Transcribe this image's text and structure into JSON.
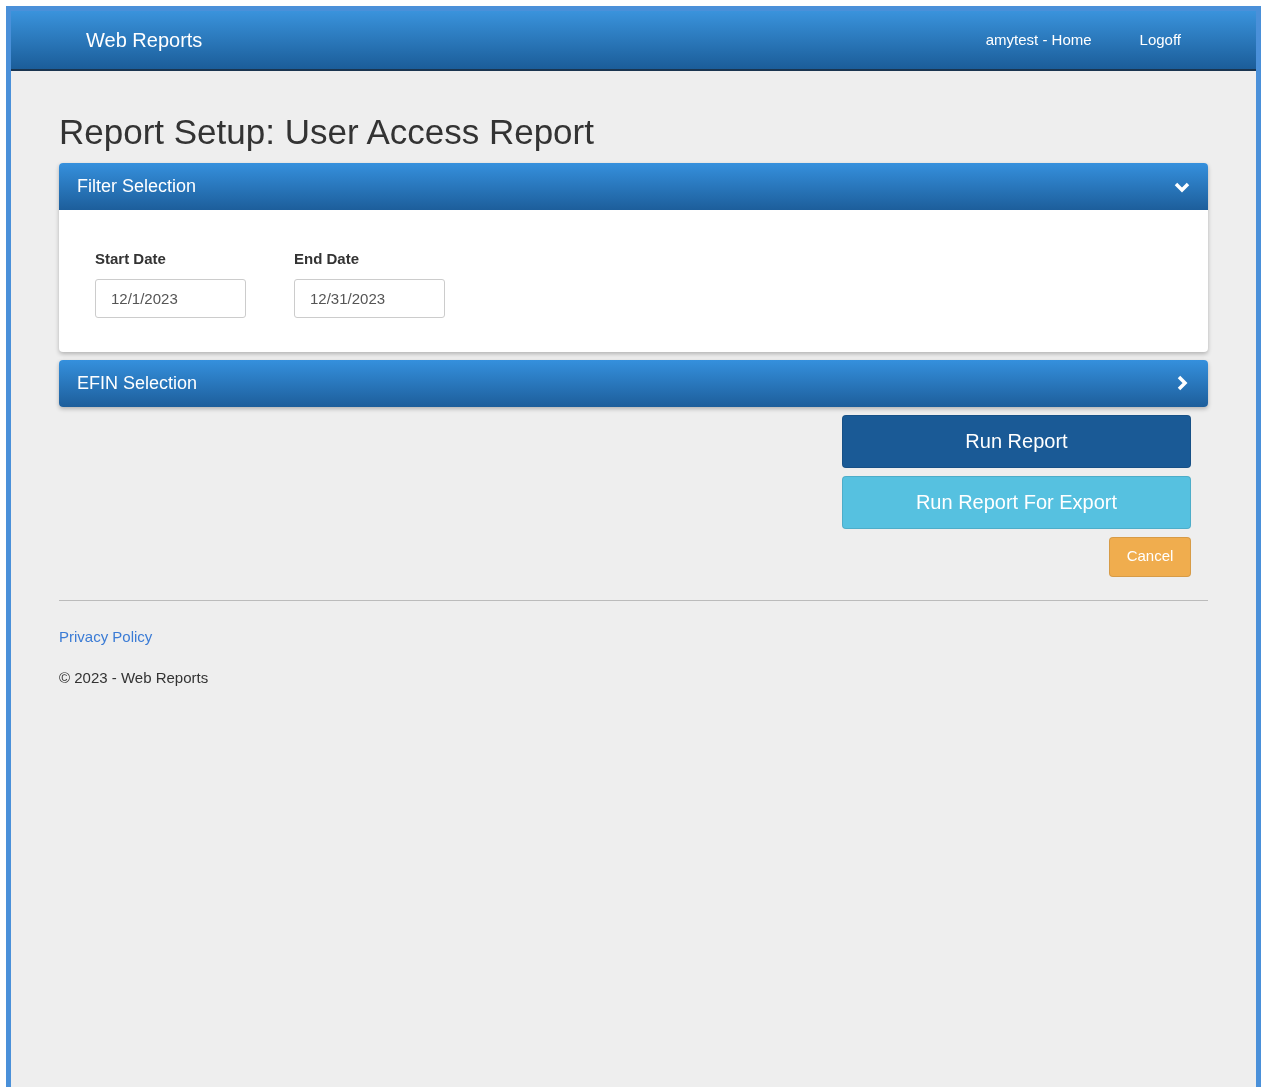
{
  "navbar": {
    "brand": "Web Reports",
    "links": [
      "amytest - Home",
      "Logoff"
    ]
  },
  "title": "Report Setup: User Access Report",
  "panels": [
    {
      "title": "Filter Selection",
      "expanded": true,
      "fields": [
        {
          "label": "Start Date",
          "value": "12/1/2023"
        },
        {
          "label": "End Date",
          "value": "12/31/2023"
        }
      ]
    },
    {
      "title": "EFIN Selection",
      "expanded": false
    }
  ],
  "buttons": [
    {
      "label": "Run Report",
      "kind": "primary"
    },
    {
      "label": "Run Report For Export",
      "kind": "info"
    },
    {
      "label": "Cancel",
      "kind": "warning"
    }
  ],
  "footer": {
    "link": "Privacy Policy",
    "copyright": "© 2023 - Web Reports"
  }
}
